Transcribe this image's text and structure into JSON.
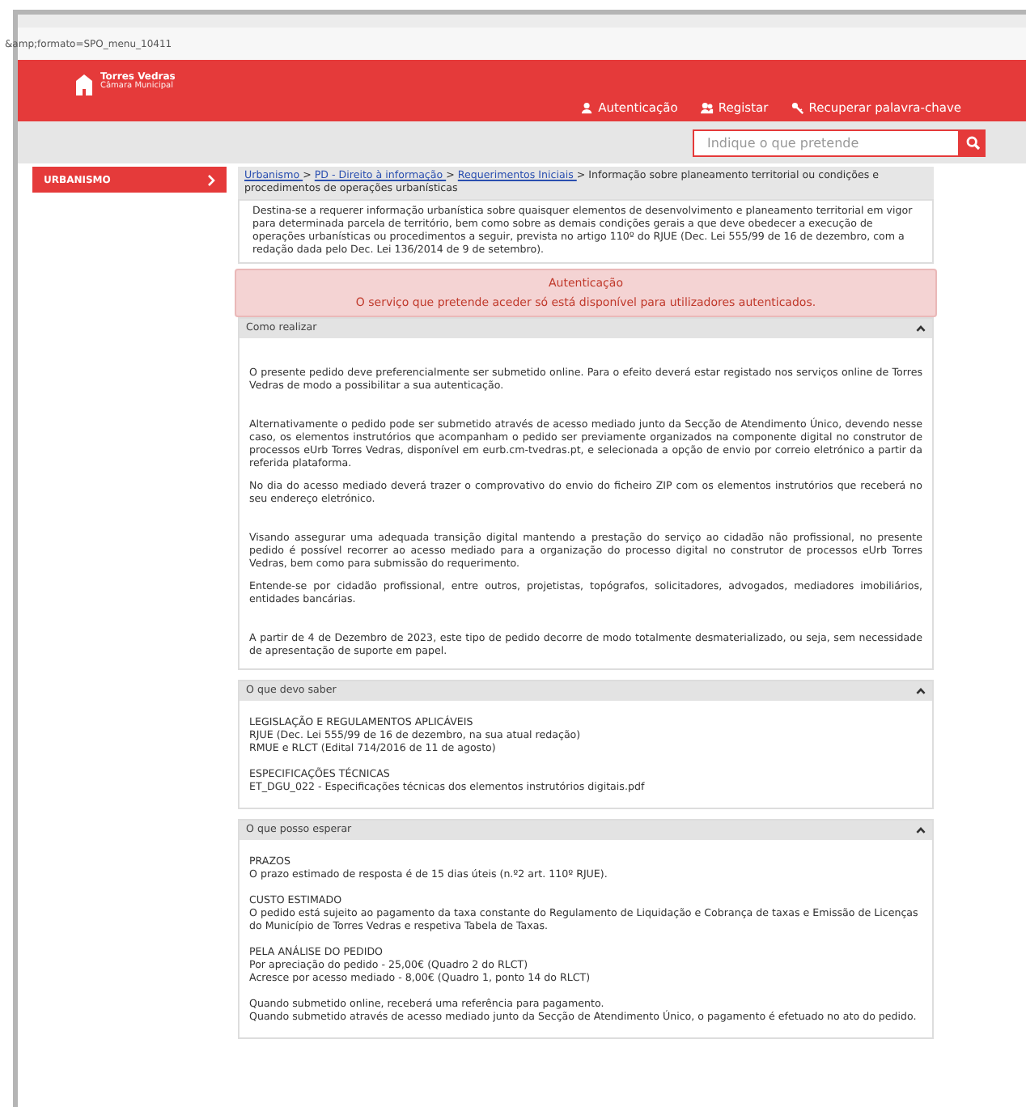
{
  "browser": {
    "url": "&amp;formato=SPO_menu_10411"
  },
  "header": {
    "logo_title": "Torres Vedras",
    "logo_subtitle": "Câmara Municipal",
    "nav": [
      {
        "label": "Autenticação",
        "kind": "user"
      },
      {
        "label": "Registar",
        "kind": "users"
      },
      {
        "label": "Recuperar palavra-chave",
        "kind": "key"
      }
    ]
  },
  "search": {
    "placeholder": "Indique o que pretende"
  },
  "sidebar": {
    "items": [
      {
        "label": "URBANISMO",
        "selected": true
      }
    ]
  },
  "breadcrumb": {
    "links": [
      "Urbanismo ",
      "PD - Direito à informação ",
      "Requerimentos Iniciais "
    ],
    "separator": ">",
    "current": [
      "Informação sobre planeamento territorial ou condições e",
      "procedimentos de operações urbanísticas"
    ]
  },
  "intro": "Destina-se a requerer informação urbanística sobre quaisquer elementos de desenvolvimento e planeamento territorial em vigor para determinada parcela de território, bem como sobre as demais condições gerais a que deve obedecer a execução de operações urbanísticas ou procedimentos a seguir, prevista no artigo 110º do RJUE (Dec. Lei 555/99 de 16 de dezembro, com a redação dada pelo Dec. Lei 136/2014 de 9 de setembro).",
  "alert": {
    "title": "Autenticação",
    "message": "O serviço que pretende aceder só está disponível para utilizadores autenticados."
  },
  "sections": [
    {
      "title": "Como realizar",
      "expanded": true,
      "kind": "paragraphs",
      "groups": [
        [
          "O presente pedido deve preferencialmente ser submetido online. Para o efeito deverá estar registado nos serviços online de Torres Vedras de modo a possibilitar a sua autenticação."
        ],
        [
          "Alternativamente o pedido pode ser submetido através de acesso mediado junto da Secção de Atendimento Único, devendo nesse caso, os elementos instrutórios que acompanham o pedido ser previamente organizados na componente digital no construtor de processos eUrb Torres Vedras, disponível em eurb.cm-tvedras.pt, e selecionada a opção de envio por correio eletrónico a partir da referida plataforma.",
          "No dia do acesso mediado deverá trazer o comprovativo do envio do ficheiro ZIP com os elementos instrutórios que receberá no seu endereço eletrónico."
        ],
        [
          "Visando assegurar uma adequada transição digital mantendo a prestação do serviço ao cidadão não profissional, no presente pedido é possível recorrer ao acesso mediado para a organização do processo digital no construtor de processos eUrb Torres Vedras, bem como para submissão do requerimento.",
          "Entende-se por cidadão profissional, entre outros, projetistas, topógrafos, solicitadores, advogados, mediadores imobiliários, entidades bancárias."
        ],
        [
          "A partir de 4 de Dezembro de 2023, este tipo de pedido decorre de modo totalmente desmaterializado, ou seja, sem necessidade de apresentação de suporte em papel."
        ]
      ]
    },
    {
      "title": "O que devo saber",
      "expanded": true,
      "kind": "lines",
      "groups": [
        [
          "LEGISLAÇÃO E REGULAMENTOS APLICÁVEIS",
          "RJUE (Dec. Lei 555/99 de 16 de dezembro, na sua atual redação)",
          "RMUE e RLCT (Edital 714/2016 de 11 de agosto)"
        ],
        [
          "ESPECIFICAÇÕES TÉCNICAS",
          "ET_DGU_022 - Especificações técnicas dos elementos instrutórios digitais.pdf"
        ]
      ]
    },
    {
      "title": "O que posso esperar",
      "expanded": true,
      "kind": "lines",
      "groups": [
        [
          "PRAZOS",
          "O prazo estimado de resposta é de 15 dias úteis (n.º2 art. 110º RJUE)."
        ],
        [
          "CUSTO ESTIMADO",
          "O pedido está sujeito ao pagamento da taxa constante do Regulamento de Liquidação e Cobrança de taxas e Emissão de Licenças do Município de Torres Vedras e respetiva Tabela de Taxas."
        ],
        [
          "PELA ANÁLISE DO PEDIDO",
          "Por apreciação do pedido - 25,00€ (Quadro 2 do RLCT)",
          "Acresce por acesso mediado - 8,00€ (Quadro 1, ponto 14 do RLCT)"
        ],
        [
          "Quando submetido online, receberá uma referência para pagamento.",
          "Quando submetido através de acesso mediado junto da Secção de Atendimento Único, o pagamento é efetuado no ato do pedido."
        ]
      ]
    }
  ]
}
